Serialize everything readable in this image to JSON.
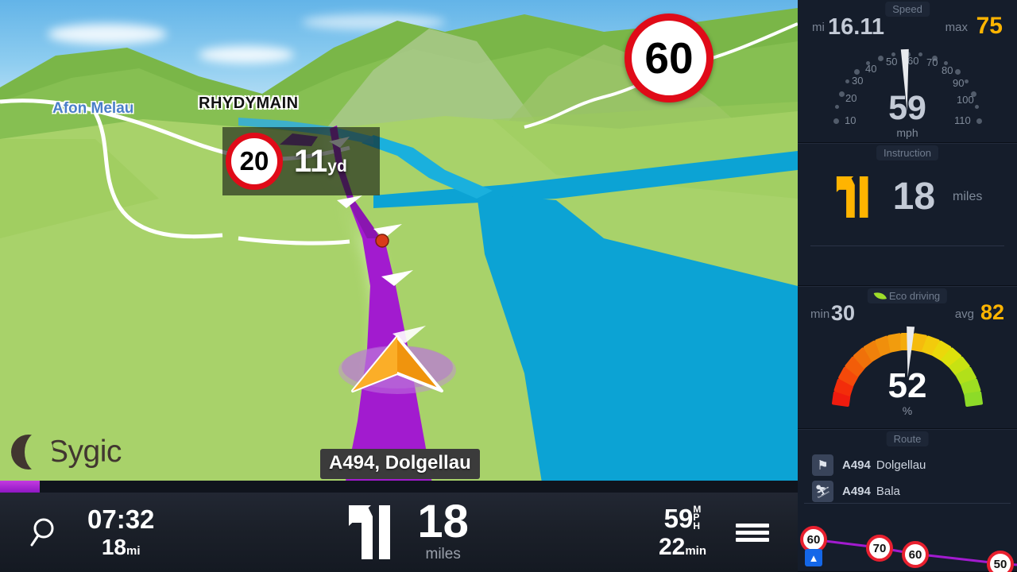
{
  "app": {
    "name": "Sygic",
    "logo_icon": "crescent-moon-icon"
  },
  "map": {
    "labels": [
      {
        "name": "river-label",
        "text": "Afon Melau",
        "color": "#4a7fc8"
      },
      {
        "name": "town-label",
        "text": "RHYDYMAIN",
        "color": "#111111"
      }
    ],
    "current_road": "A494, Dolgellau",
    "current_speed_limit": "60",
    "next_instruction_card": {
      "speed_limit": "20",
      "distance": "11",
      "distance_unit": "yd"
    },
    "colors": {
      "route": "#a21bcf",
      "water": "#0ca3d4",
      "grass": "#a8d26a",
      "sky": "#8ecdf0",
      "position_arrow": "#f0940d"
    }
  },
  "bottom_bar": {
    "search_icon": "search-icon",
    "eta_time": "07:32",
    "remaining_distance": "18",
    "remaining_distance_unit": "mi",
    "maneuver_icon": "fork-left-icon",
    "maneuver_distance": "18",
    "maneuver_distance_unit": "miles",
    "speed": "59",
    "speed_unit": "MPH",
    "remaining_time": "22",
    "remaining_time_unit": "min",
    "menu_icon": "hamburger-menu-icon",
    "progress_percent": 5
  },
  "sidebar": {
    "speed_panel": {
      "title": "Speed",
      "odometer_label": "mi",
      "odometer_value": "16.11",
      "max_label": "max",
      "max_value": "75",
      "gauge": {
        "value": "59",
        "unit": "mph",
        "ticks": [
          "10",
          "20",
          "30",
          "40",
          "50",
          "60",
          "70",
          "80",
          "90",
          "100",
          "110"
        ],
        "min": 0,
        "max": 120
      }
    },
    "instruction_panel": {
      "title": "Instruction",
      "icon": "fork-left-icon",
      "distance": "18",
      "distance_unit": "miles"
    },
    "eco_panel": {
      "title": "Eco driving",
      "icon": "leaf-icon",
      "min_label": "min",
      "min_value": "30",
      "avg_label": "avg",
      "avg_value": "82",
      "gauge": {
        "value": "52",
        "unit": "%",
        "min": 0,
        "max": 100
      }
    },
    "route_panel": {
      "title": "Route",
      "waypoints": [
        {
          "icon": "flag-icon",
          "road": "A494",
          "place": "Dolgellau"
        },
        {
          "icon": "checkered-flag-icon",
          "road": "A494",
          "place": "Bala"
        }
      ],
      "speed_profile": {
        "limits": [
          "60",
          "70",
          "60",
          "50"
        ],
        "badge_icon": "motorway-icon"
      }
    }
  }
}
